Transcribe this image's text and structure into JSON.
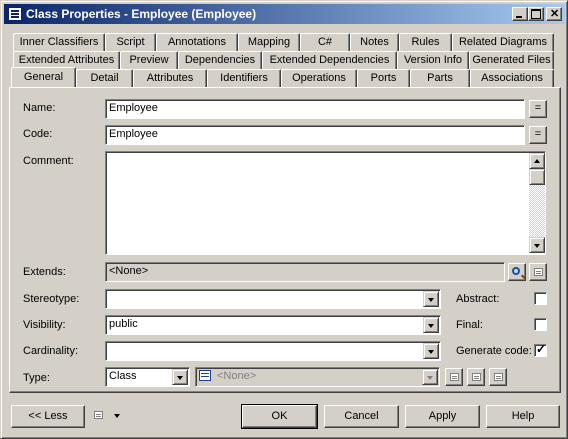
{
  "window": {
    "title": "Class Properties - Employee (Employee)"
  },
  "tabs": {
    "row1": [
      "Inner Classifiers",
      "Script",
      "Annotations",
      "Mapping",
      "C#",
      "Notes",
      "Rules",
      "Related Diagrams"
    ],
    "row2": [
      "Extended Attributes",
      "Preview",
      "Dependencies",
      "Extended Dependencies",
      "Version Info",
      "Generated Files"
    ],
    "row3": [
      "General",
      "Detail",
      "Attributes",
      "Identifiers",
      "Operations",
      "Ports",
      "Parts",
      "Associations"
    ],
    "active": "General"
  },
  "form": {
    "name": {
      "label": "Name:",
      "value": "Employee",
      "button": "="
    },
    "code": {
      "label": "Code:",
      "value": "Employee",
      "button": "="
    },
    "comment": {
      "label": "Comment:",
      "value": ""
    },
    "extends": {
      "label": "Extends:",
      "value": "<None>"
    },
    "stereotype": {
      "label": "Stereotype:",
      "value": ""
    },
    "visibility": {
      "label": "Visibility:",
      "value": "public"
    },
    "cardinality": {
      "label": "Cardinality:",
      "value": ""
    },
    "type": {
      "label": "Type:",
      "value": "Class",
      "classifier": "<None>"
    },
    "abstract": {
      "label": "Abstract:",
      "checked": false
    },
    "final": {
      "label": "Final:",
      "checked": false
    },
    "generate_code": {
      "label": "Generate code:",
      "checked": true
    }
  },
  "buttons": {
    "less": "<< Less",
    "ok": "OK",
    "cancel": "Cancel",
    "apply": "Apply",
    "help": "Help"
  }
}
